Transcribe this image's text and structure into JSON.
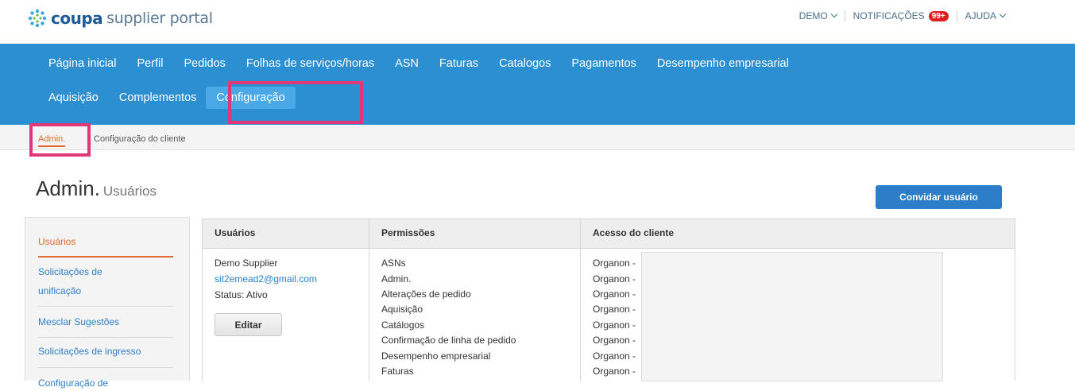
{
  "header": {
    "logo_brand": "coupa",
    "logo_rest": "supplier portal",
    "demo_label": "DEMO",
    "notifications_label": "NOTIFICAÇÕES",
    "notifications_count": "99+",
    "help_label": "AJUDA"
  },
  "nav": {
    "row1": [
      "Página inicial",
      "Perfil",
      "Pedidos",
      "Folhas de serviços/horas",
      "ASN",
      "Faturas",
      "Catalogos",
      "Pagamentos",
      "Desempenho empresarial"
    ],
    "row2": [
      "Aquisição",
      "Complementos",
      "Configuração"
    ],
    "active": "Configuração"
  },
  "subnav": {
    "admin": "Admin.",
    "client_config": "Configuração do cliente"
  },
  "page": {
    "title": "Admin.",
    "subtitle": "Usuários",
    "invite_button": "Convidar usuário"
  },
  "sidebar": {
    "items": [
      {
        "label": "Usuários"
      },
      {
        "label_line1": "Solicitações de",
        "label_line2": "unificação"
      },
      {
        "label": "Mesclar Sugestões"
      },
      {
        "label": "Solicitações de ingresso"
      },
      {
        "label": "Configuração de"
      }
    ]
  },
  "table": {
    "headers": {
      "users": "Usuários",
      "permissions": "Permissões",
      "access": "Acesso do cliente"
    },
    "user": {
      "name": "Demo Supplier",
      "email": "sit2emead2@gmail.com",
      "status": "Status: Ativo",
      "edit": "Editar"
    },
    "permissions": [
      "ASNs",
      "Admin.",
      "Alterações de pedido",
      "Aquisição",
      "Catálogos",
      "Confirmação de linha de pedido",
      "Desempenho empresarial",
      "Faturas"
    ],
    "access": [
      "Organon -",
      "Organon -",
      "Organon -",
      "Organon -",
      "Organon -",
      "Organon -",
      "Organon -",
      "Organon -"
    ]
  },
  "colors": {
    "nav_blue": "#2b8fd2",
    "accent_orange": "#e06a2d",
    "highlight_pink": "#e0367a",
    "link_blue": "#2c7ec8"
  }
}
